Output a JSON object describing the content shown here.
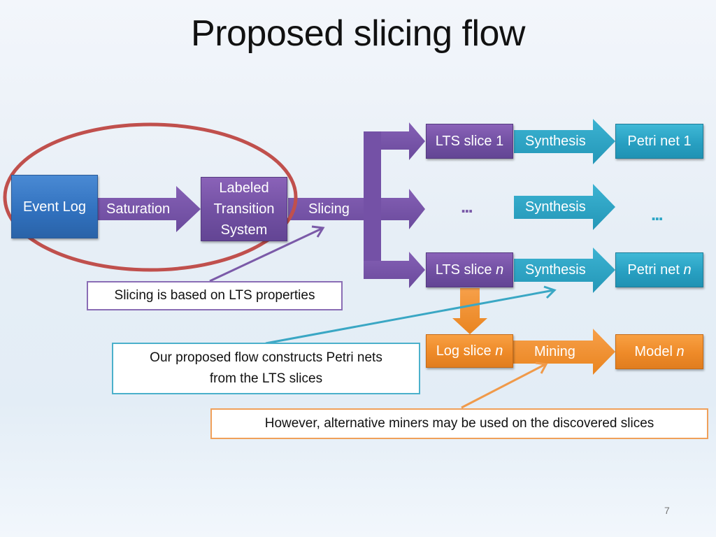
{
  "slide": {
    "title": "Proposed slicing flow",
    "page_number": "7"
  },
  "colors": {
    "event_log": "#3070bd",
    "lts": "#7150a2",
    "synthesis": "#28a0c2",
    "mining": "#ee8a28",
    "highlight_ellipse": "#c0504d"
  },
  "nodes": {
    "event_log": "Event Log",
    "lts_line1": "Labeled",
    "lts_line2": "Transition",
    "lts_line3": "System",
    "lts_slice_1": "LTS slice 1",
    "lts_slice_n_prefix": "LTS slice ",
    "lts_slice_n_var": "n",
    "petri_net_1": "Petri net 1",
    "petri_net_n_prefix": "Petri net ",
    "petri_net_n_var": "n",
    "log_slice_n_prefix": "Log slice ",
    "log_slice_n_var": "n",
    "model_n_prefix": "Model ",
    "model_n_var": "n",
    "ellipsis": "..."
  },
  "arrows": {
    "saturation": "Saturation",
    "slicing": "Slicing",
    "synthesis": "Synthesis",
    "mining": "Mining"
  },
  "callouts": {
    "slicing_note": "Slicing is based on LTS properties",
    "petri_note_line1": "Our proposed flow constructs Petri nets",
    "petri_note_line2": "from the LTS slices",
    "miners_note": "However, alternative miners may be used on the discovered slices"
  }
}
